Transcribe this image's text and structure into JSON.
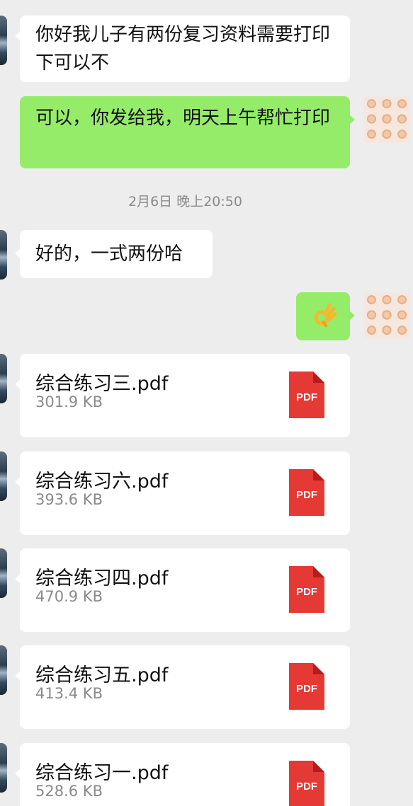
{
  "messages": {
    "m1_text": "你好我儿子有两份复习资料需要打印下可以不",
    "m2_text": "可以，你发给我，明天上午帮忙打印",
    "timestamp": "2月6日 晚上20:50",
    "m3_text": "好的，一式两份哈",
    "m4_emoji": "ok-hand-emoji"
  },
  "files": [
    {
      "name": "综合练习三.pdf",
      "size": "301.9 KB",
      "type": "PDF"
    },
    {
      "name": "综合练习六.pdf",
      "size": "393.6 KB",
      "type": "PDF"
    },
    {
      "name": "综合练习四.pdf",
      "size": "470.9 KB",
      "type": "PDF"
    },
    {
      "name": "综合练习五.pdf",
      "size": "413.4 KB",
      "type": "PDF"
    },
    {
      "name": "综合练习一.pdf",
      "size": "528.6 KB",
      "type": "PDF"
    }
  ],
  "colors": {
    "background": "#ededed",
    "sent_bubble": "#95ec69",
    "received_bubble": "#ffffff",
    "pdf_red": "#e53935",
    "meta_text": "#8a8a8a"
  }
}
